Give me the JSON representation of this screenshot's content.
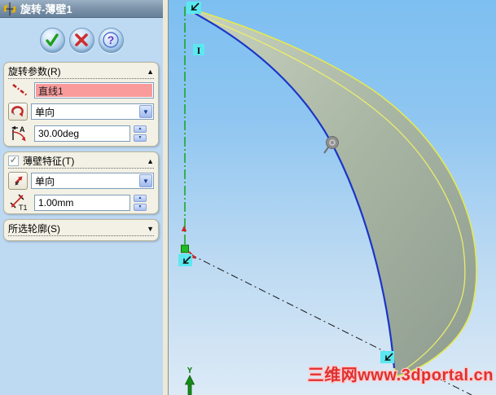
{
  "titlebar": {
    "title": "旋转-薄壁1"
  },
  "revolve_params": {
    "header": "旋转参数(R)",
    "axis_value": "直线1",
    "direction_value": "单向",
    "angle_value": "30.00deg"
  },
  "thin_feature": {
    "header": "薄壁特征(T)",
    "checked": true,
    "direction_value": "单向",
    "thickness_value": "1.00mm"
  },
  "selected_contours": {
    "header": "所选轮廓(S)"
  },
  "viewport": {
    "watermark": "三维网www.3dportal.cn",
    "origin_axis_label": "Y",
    "relation_label": "I"
  },
  "glyphs": {
    "collapse": "▲",
    "expand": "▼",
    "dropdown": "▼",
    "spin_up": "▲",
    "spin_down": "▼",
    "check": "✓",
    "help": "?"
  },
  "colors": {
    "selection_pink": "#F99B9B",
    "highlight_yellow": "#E6E94E",
    "sketch_blue": "#1A35C8",
    "axis_green": "#17A317",
    "watermark_red": "#E03030",
    "panel_blue": "#BED9F2"
  }
}
